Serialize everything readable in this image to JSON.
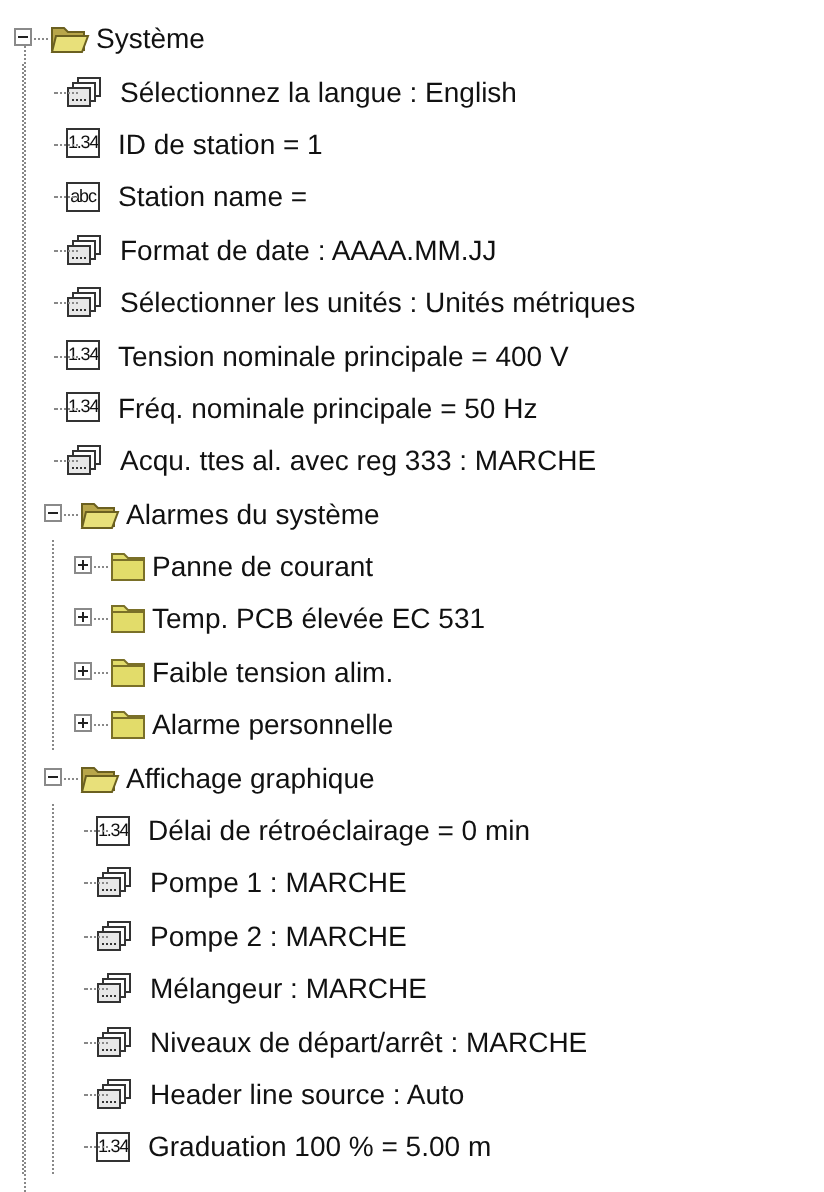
{
  "tree": [
    {
      "label": "Système",
      "kind": "folder",
      "expanded": true,
      "children": [
        {
          "label": "Sélectionnez la langue : English",
          "kind": "list"
        },
        {
          "label": "ID de station = 1",
          "kind": "number",
          "icon_text": "1.34"
        },
        {
          "label": "Station name =",
          "kind": "text",
          "icon_text": "abc"
        },
        {
          "label": "Format de date : AAAA.MM.JJ",
          "kind": "list"
        },
        {
          "label": "Sélectionner les unités : Unités métriques",
          "kind": "list"
        },
        {
          "label": "Tension nominale principale = 400 V",
          "kind": "number",
          "icon_text": "1.34"
        },
        {
          "label": "Fréq. nominale principale = 50 Hz",
          "kind": "number",
          "icon_text": "1.34"
        },
        {
          "label": "Acqu. ttes al. avec reg 333 : MARCHE",
          "kind": "list"
        },
        {
          "label": "Alarmes du système",
          "kind": "folder",
          "expanded": true,
          "children": [
            {
              "label": "Panne de courant",
              "kind": "folder",
              "expanded": false
            },
            {
              "label": "Temp. PCB élevée EC 531",
              "kind": "folder",
              "expanded": false
            },
            {
              "label": "Faible tension alim.",
              "kind": "folder",
              "expanded": false
            },
            {
              "label": "Alarme personnelle",
              "kind": "folder",
              "expanded": false
            }
          ]
        },
        {
          "label": "Affichage graphique",
          "kind": "folder",
          "expanded": true,
          "children": [
            {
              "label": "Délai de rétroéclairage = 0 min",
              "kind": "number",
              "icon_text": "1.34"
            },
            {
              "label": "Pompe 1 : MARCHE",
              "kind": "list"
            },
            {
              "label": "Pompe 2 : MARCHE",
              "kind": "list"
            },
            {
              "label": "Mélangeur : MARCHE",
              "kind": "list"
            },
            {
              "label": "Niveaux de départ/arrêt : MARCHE",
              "kind": "list"
            },
            {
              "label": "Header line source : Auto",
              "kind": "list"
            },
            {
              "label": "Graduation 100 % = 5.00 m",
              "kind": "number",
              "icon_text": "1.34"
            }
          ]
        }
      ]
    }
  ]
}
